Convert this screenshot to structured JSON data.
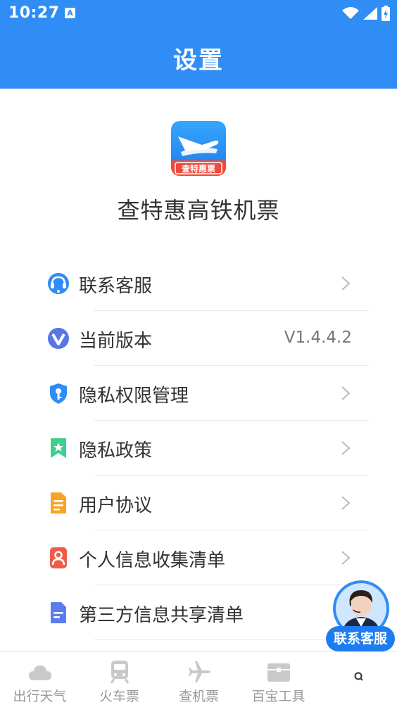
{
  "status": {
    "time": "10:27",
    "badge": "A"
  },
  "header": {
    "title": "设置"
  },
  "app": {
    "name": "查特惠高铁机票",
    "logo_text": "查特惠票"
  },
  "menu": [
    {
      "label": "联系客服",
      "icon": "customer-service-icon"
    },
    {
      "label": "当前版本",
      "icon": "version-icon",
      "value": "V1.4.4.2"
    },
    {
      "label": "隐私权限管理",
      "icon": "shield-key-icon"
    },
    {
      "label": "隐私政策",
      "icon": "bookmark-star-icon"
    },
    {
      "label": "用户协议",
      "icon": "document-icon"
    },
    {
      "label": "个人信息收集清单",
      "icon": "person-icon"
    },
    {
      "label": "第三方信息共享清单",
      "icon": "list-document-icon"
    }
  ],
  "agent": {
    "label": "联系客服"
  },
  "tabs": [
    {
      "label": "出行天气",
      "icon": "cloud-icon"
    },
    {
      "label": "火车票",
      "icon": "train-icon"
    },
    {
      "label": "查机票",
      "icon": "plane-icon"
    },
    {
      "label": "百宝工具",
      "icon": "toolbox-icon"
    },
    {
      "label": "",
      "icon": "search-icon"
    }
  ],
  "colors": {
    "primary": "#2f8df5",
    "tab_inactive": "#999999"
  }
}
